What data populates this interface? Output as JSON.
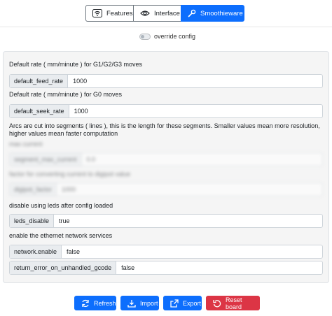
{
  "tabs": [
    {
      "label": "Features",
      "icon": "wifi-box-icon",
      "active": false
    },
    {
      "label": "Interface",
      "icon": "eye-icon",
      "active": false
    },
    {
      "label": "Smoothieware",
      "icon": "wrench-icon",
      "active": true
    }
  ],
  "override": {
    "label": "override config",
    "enabled": false
  },
  "settings": {
    "feed_rate_desc": "Default rate ( mm/minute ) for G1/G2/G3 moves",
    "feed_rate_name": "default_feed_rate",
    "feed_rate_value": "1000",
    "seek_rate_desc": "Default rate ( mm/minute ) for G0 moves",
    "seek_rate_name": "default_seek_rate",
    "seek_rate_value": "1000",
    "arc_desc": "Arcs are cut into segments ( lines ), this is the length for these segments. Smaller values mean more resolution, higher values mean faster computation",
    "arc_blur_desc": "max current",
    "arc_blur_name": "segment_max_current",
    "arc_blur_value": "0.0",
    "current_blur_desc": "factor for converting current to digipot value",
    "current_blur_name": "digipot_factor",
    "current_blur_value": "1000",
    "leds_desc": "disable using leds after config loaded",
    "leds_name": "leds_disable",
    "leds_value": "true",
    "net_desc": "enable the ethernet network services",
    "net_name": "network.enable",
    "net_value": "false",
    "gcode_name": "return_error_on_unhandled_gcode",
    "gcode_value": "false"
  },
  "actions": {
    "refresh": "Refresh",
    "import": "Import",
    "export": "Export",
    "reset": "Reset board"
  },
  "colors": {
    "primary": "#0d6efd",
    "danger": "#dc3545"
  }
}
